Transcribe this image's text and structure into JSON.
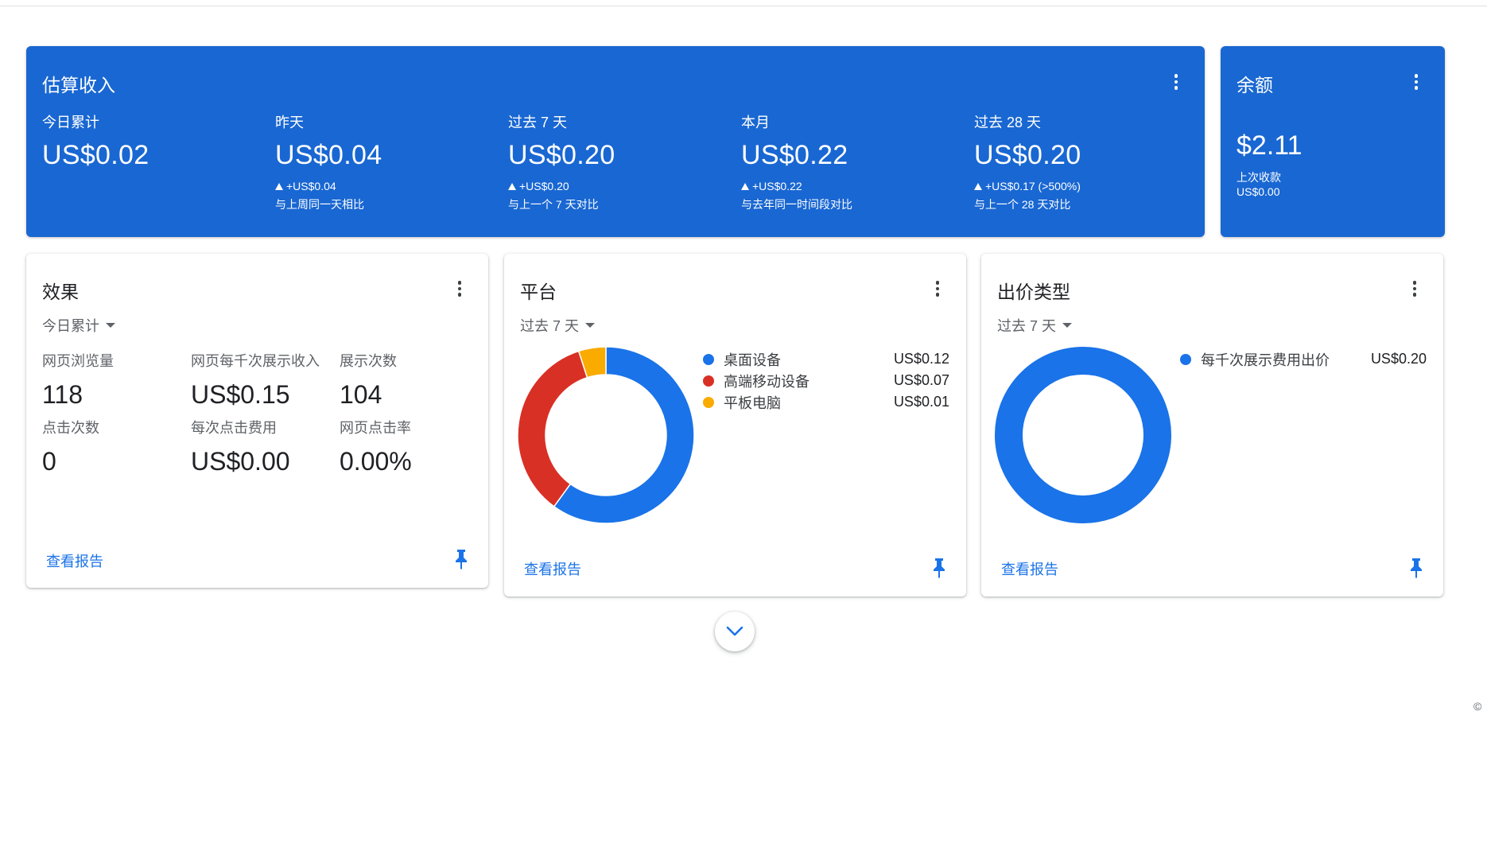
{
  "earnings": {
    "title": "估算收入",
    "metrics": [
      {
        "label": "今日累计",
        "value": "US$0.02",
        "delta": "",
        "compare": ""
      },
      {
        "label": "昨天",
        "value": "US$0.04",
        "delta": "+US$0.04",
        "compare": "与上周同一天相比"
      },
      {
        "label": "过去 7 天",
        "value": "US$0.20",
        "delta": "+US$0.20",
        "compare": "与上一个 7 天对比"
      },
      {
        "label": "本月",
        "value": "US$0.22",
        "delta": "+US$0.22",
        "compare": "与去年同一时间段对比"
      },
      {
        "label": "过去 28 天",
        "value": "US$0.20",
        "delta": "+US$0.17 (>500%)",
        "compare": "与上一个 28 天对比"
      }
    ]
  },
  "balance": {
    "title": "余额",
    "value": "$2.11",
    "last_payment_label": "上次收款",
    "last_payment_value": "US$0.00"
  },
  "performance": {
    "title": "效果",
    "range": "今日累计",
    "metrics": [
      {
        "label": "网页浏览量",
        "value": "118"
      },
      {
        "label": "网页每千次展示收入",
        "value": "US$0.15"
      },
      {
        "label": "展示次数",
        "value": "104"
      },
      {
        "label": "点击次数",
        "value": "0"
      },
      {
        "label": "每次点击费用",
        "value": "US$0.00"
      },
      {
        "label": "网页点击率",
        "value": "0.00%"
      }
    ],
    "view_report": "查看报告"
  },
  "platform": {
    "title": "平台",
    "range": "过去 7 天",
    "legend": [
      {
        "name": "桌面设备",
        "value": "US$0.12",
        "color": "#1a73e8"
      },
      {
        "name": "高端移动设备",
        "value": "US$0.07",
        "color": "#d93025"
      },
      {
        "name": "平板电脑",
        "value": "US$0.01",
        "color": "#f9ab00"
      }
    ],
    "view_report": "查看报告"
  },
  "bid_type": {
    "title": "出价类型",
    "range": "过去 7 天",
    "legend": [
      {
        "name": "每千次展示费用出价",
        "value": "US$0.20",
        "color": "#1a73e8"
      }
    ],
    "view_report": "查看报告"
  },
  "chart_data": [
    {
      "type": "pie",
      "categories": [
        "桌面设备",
        "高端移动设备",
        "平板电脑"
      ],
      "values": [
        0.12,
        0.07,
        0.01
      ],
      "colors": [
        "#1a73e8",
        "#d93025",
        "#f9ab00"
      ],
      "title": "平台"
    },
    {
      "type": "pie",
      "categories": [
        "每千次展示费用出价"
      ],
      "values": [
        0.2
      ],
      "colors": [
        "#1a73e8"
      ],
      "title": "出价类型"
    }
  ],
  "footer": {
    "copyright": "©"
  }
}
